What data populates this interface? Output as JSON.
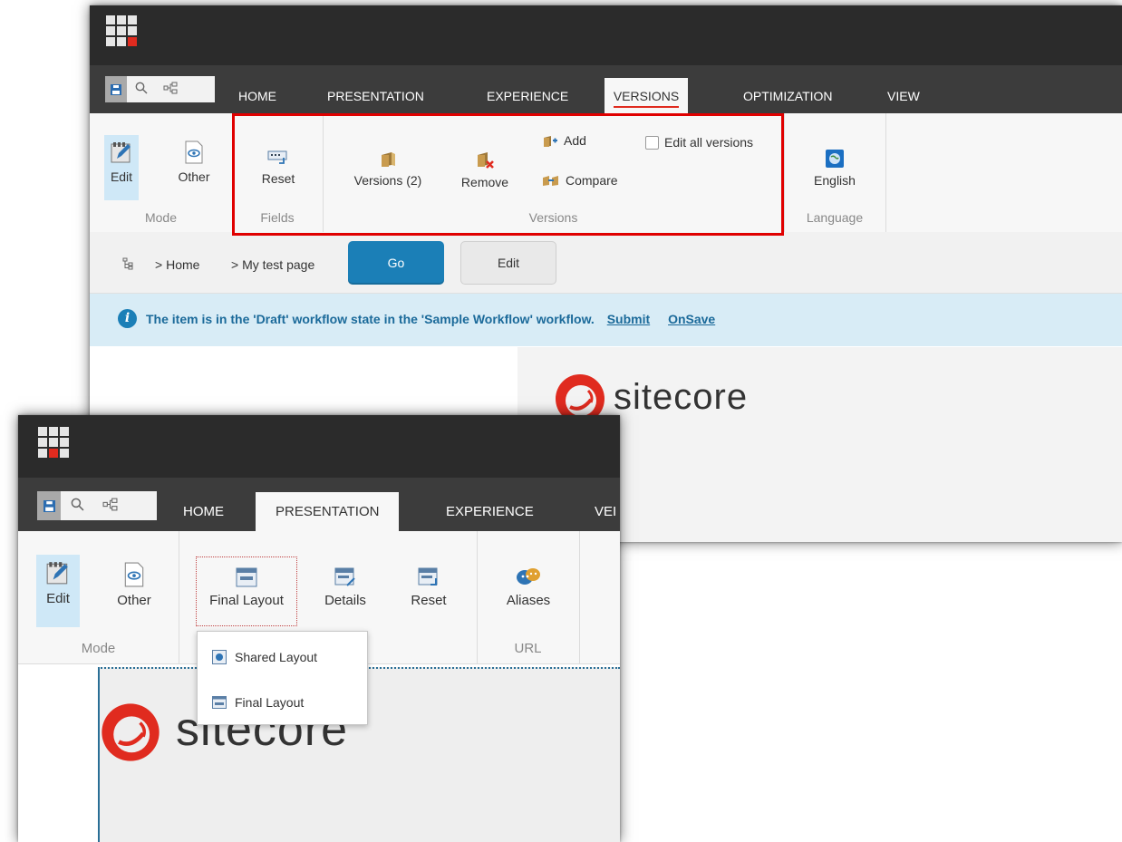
{
  "window_back": {
    "tabs": [
      "HOME",
      "PRESENTATION",
      "EXPERIENCE",
      "VERSIONS",
      "OPTIMIZATION",
      "VIEW"
    ],
    "active_tab": "VERSIONS",
    "ribbon": {
      "mode": {
        "edit": "Edit",
        "other": "Other",
        "label": "Mode"
      },
      "fields": {
        "reset": "Reset",
        "label": "Fields"
      },
      "versions": {
        "versions": "Versions (2)",
        "remove": "Remove",
        "add": "Add",
        "compare": "Compare",
        "edit_all": "Edit all versions",
        "label": "Versions"
      },
      "language": {
        "english": "English",
        "label": "Language"
      }
    },
    "breadcrumb": {
      "home": "Home",
      "page": "My test page"
    },
    "go_label": "Go",
    "edit_label": "Edit",
    "notice": {
      "text": "The item is in the 'Draft' workflow state in the 'Sample Workflow' workflow.",
      "submit": "Submit",
      "onsave": "OnSave"
    },
    "brand": "sitecore"
  },
  "window_front": {
    "tabs": [
      "HOME",
      "PRESENTATION",
      "EXPERIENCE",
      "VEI"
    ],
    "active_tab": "PRESENTATION",
    "ribbon": {
      "mode": {
        "edit": "Edit",
        "other": "Other",
        "label": "Mode"
      },
      "layout": {
        "final_layout": "Final Layout",
        "details": "Details",
        "reset": "Reset"
      },
      "url": {
        "aliases": "Aliases",
        "label": "URL"
      }
    },
    "dropdown": {
      "shared": "Shared Layout",
      "final": "Final Layout"
    },
    "brand": "sitecore"
  },
  "colors": {
    "accent_red": "#e02b1f",
    "go_blue": "#1b7fb7",
    "info_bg": "#d8ecf6",
    "topbar": "#2b2b2b",
    "tabbar": "#3c3c3c"
  }
}
